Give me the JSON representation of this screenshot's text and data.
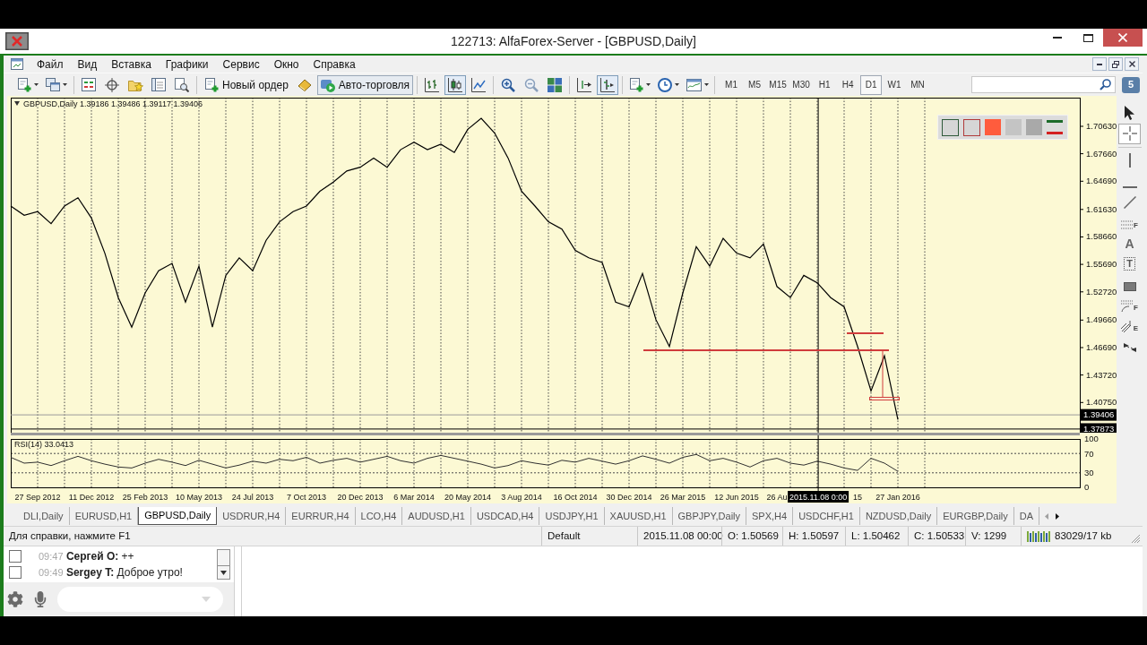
{
  "window": {
    "title": "122713: AlfaForex-Server - [GBPUSD,Daily]"
  },
  "menu": [
    "Файл",
    "Вид",
    "Вставка",
    "Графики",
    "Сервис",
    "Окно",
    "Справка"
  ],
  "toolbar": {
    "new_order": "Новый ордер",
    "autotrading": {
      "label": "Авто-торговля",
      "selected": true
    },
    "chart_types": [
      {
        "kind": "bars",
        "selected": false
      },
      {
        "kind": "candles",
        "selected": true
      },
      {
        "kind": "line",
        "selected": false
      }
    ],
    "scroll_modes": [
      {
        "kind": "shift",
        "selected": false
      },
      {
        "kind": "autoscroll",
        "selected": true
      }
    ],
    "periods": [
      {
        "label": "M1",
        "selected": false
      },
      {
        "label": "M5",
        "selected": false
      },
      {
        "label": "M15",
        "selected": false
      },
      {
        "label": "M30",
        "selected": false
      },
      {
        "label": "H1",
        "selected": false
      },
      {
        "label": "H4",
        "selected": false
      },
      {
        "label": "D1",
        "selected": true
      },
      {
        "label": "W1",
        "selected": false
      },
      {
        "label": "MN",
        "selected": false
      }
    ],
    "community": "5"
  },
  "chart": {
    "price_pane": {
      "chart_data": {
        "type": "line",
        "title": "GBPUSD,Daily  1.39186 1.39486 1.39117 1.39406",
        "values": [
          1.62,
          1.61,
          1.614,
          1.601,
          1.62,
          1.629,
          1.607,
          1.569,
          1.521,
          1.489,
          1.526,
          1.55,
          1.558,
          1.516,
          1.555,
          1.489,
          1.545,
          1.564,
          1.55,
          1.583,
          1.603,
          1.614,
          1.62,
          1.636,
          1.646,
          1.658,
          1.662,
          1.672,
          1.662,
          1.681,
          1.689,
          1.681,
          1.687,
          1.678,
          1.703,
          1.715,
          1.699,
          1.672,
          1.636,
          1.62,
          1.603,
          1.595,
          1.572,
          1.564,
          1.559,
          1.516,
          1.511,
          1.547,
          1.497,
          1.468,
          1.526,
          1.576,
          1.555,
          1.585,
          1.569,
          1.564,
          1.579,
          1.533,
          1.521,
          1.545,
          1.537,
          1.521,
          1.511,
          1.468,
          1.42,
          1.458,
          1.389
        ],
        "ylim": [
          1.3748,
          1.7373
        ],
        "grid": true,
        "yticks": [
          {
            "value": 1.7063,
            "label": "1.70630"
          },
          {
            "value": 1.6766,
            "label": "1.67660"
          },
          {
            "value": 1.6469,
            "label": "1.64690"
          },
          {
            "value": 1.6163,
            "label": "1.61630"
          },
          {
            "value": 1.5866,
            "label": "1.58660"
          },
          {
            "value": 1.5569,
            "label": "1.55690"
          },
          {
            "value": 1.5272,
            "label": "1.52720"
          },
          {
            "value": 1.4966,
            "label": "1.49660"
          },
          {
            "value": 1.4669,
            "label": "1.46690"
          },
          {
            "value": 1.4372,
            "label": "1.43720"
          },
          {
            "value": 1.4075,
            "label": "1.40750"
          }
        ],
        "ref_lines": [
          {
            "axis": "y",
            "value": 1.39406,
            "label": "1.39406",
            "color": "#9a9a9a"
          },
          {
            "axis": "y",
            "value": 1.37873,
            "label": "1.37873",
            "color": "#000000"
          }
        ]
      }
    },
    "rsi_pane": {
      "chart_data": {
        "type": "line",
        "title": "RSI(14) 33.0413",
        "categories": [
          null,
          null,
          "27 Sep 2012",
          null,
          null,
          null,
          "11 Dec 2012",
          null,
          null,
          null,
          "25 Feb 2013",
          null,
          null,
          null,
          "10 May 2013",
          null,
          null,
          null,
          "24 Jul 2013",
          null,
          null,
          null,
          "7 Oct 2013",
          null,
          null,
          null,
          "20 Dec 2013",
          null,
          null,
          null,
          "6 Mar 2014",
          null,
          null,
          null,
          "20 May 2014",
          null,
          null,
          null,
          "3 Aug 2014",
          null,
          null,
          null,
          "16 Oct 2014",
          null,
          null,
          null,
          "30 Dec 2014",
          null,
          null,
          null,
          "26 Mar 2015",
          null,
          null,
          null,
          "12 Jun 2015",
          null,
          null,
          "26 Au",
          null,
          null,
          null,
          null,
          null,
          "15",
          null,
          null,
          "27 Jan 2016"
        ],
        "values": [
          62,
          50,
          52,
          45,
          55,
          64,
          55,
          48,
          42,
          40,
          50,
          58,
          52,
          45,
          56,
          48,
          40,
          46,
          54,
          50,
          58,
          55,
          62,
          50,
          56,
          60,
          52,
          58,
          64,
          55,
          50,
          60,
          66,
          60,
          54,
          48,
          40,
          45,
          55,
          50,
          46,
          56,
          52,
          60,
          54,
          48,
          55,
          65,
          58,
          50,
          62,
          68,
          55,
          60,
          52,
          42,
          55,
          60,
          50,
          46,
          54,
          48,
          40,
          35,
          60,
          50,
          33
        ],
        "ylim": [
          0,
          100
        ],
        "grid": true,
        "yticks": [
          100,
          70,
          30,
          0
        ]
      }
    },
    "crosshair": {
      "date_label": "2015.11.08 0:00"
    },
    "color_panel": [
      {
        "kind": "outline",
        "color": "#2f5a3a"
      },
      {
        "kind": "outline",
        "color": "#b03a3a"
      },
      {
        "kind": "fill",
        "color": "#ff5c3d"
      },
      {
        "kind": "fill",
        "color": "#c4c4c4"
      },
      {
        "kind": "fill",
        "color": "#a9a9a9"
      },
      {
        "kind": "levels"
      }
    ]
  },
  "drawing_tools": [
    {
      "kind": "cursor",
      "selected": false
    },
    {
      "kind": "crosshair",
      "selected": true
    },
    {
      "kind": "vline",
      "selected": false
    },
    {
      "kind": "hline",
      "selected": false
    },
    {
      "kind": "trend",
      "selected": false
    },
    {
      "kind": "fibo",
      "label": "F",
      "selected": false
    },
    {
      "kind": "text",
      "label": "A",
      "selected": false
    },
    {
      "kind": "label",
      "label": "T",
      "selected": false
    },
    {
      "kind": "rect",
      "selected": false
    },
    {
      "kind": "fibo_arcs",
      "label": "F",
      "selected": false
    },
    {
      "kind": "pitchfork",
      "label": "E",
      "selected": false
    },
    {
      "kind": "arrows",
      "selected": false
    }
  ],
  "tabs": [
    {
      "label": "DLI,Daily",
      "selected": false
    },
    {
      "label": "EURUSD,H1",
      "selected": false
    },
    {
      "label": "GBPUSD,Daily",
      "selected": true
    },
    {
      "label": "USDRUR,H4",
      "selected": false
    },
    {
      "label": "EURRUR,H4",
      "selected": false
    },
    {
      "label": "LCO,H4",
      "selected": false
    },
    {
      "label": "AUDUSD,H1",
      "selected": false
    },
    {
      "label": "USDCAD,H4",
      "selected": false
    },
    {
      "label": "USDJPY,H1",
      "selected": false
    },
    {
      "label": "XAUUSD,H1",
      "selected": false
    },
    {
      "label": "GBPJPY,Daily",
      "selected": false
    },
    {
      "label": "SPX,H4",
      "selected": false
    },
    {
      "label": "USDCHF,H1",
      "selected": false
    },
    {
      "label": "NZDUSD,Daily",
      "selected": false
    },
    {
      "label": "EURGBP,Daily",
      "selected": false
    },
    {
      "label": "DA",
      "selected": false
    }
  ],
  "tab_scroll": [
    {
      "kind": "left",
      "disabled": true
    },
    {
      "kind": "right",
      "disabled": false
    }
  ],
  "status_bar": {
    "help": "Для справки, нажмите F1",
    "profile": "Default",
    "time": "2015.11.08 00:00",
    "open": "O: 1.50569",
    "high": "H: 1.50597",
    "low": "L: 1.50462",
    "close": "C: 1.50533",
    "volume": "V: 1299",
    "traffic": "83029/17 kb"
  },
  "chat": {
    "messages": [
      {
        "time": "09:47",
        "author": "Сергей О:",
        "text": "++",
        "checked": false
      },
      {
        "time": "09:49",
        "author": "Sergey T:",
        "text": "Доброе утро!",
        "checked": false
      }
    ]
  }
}
